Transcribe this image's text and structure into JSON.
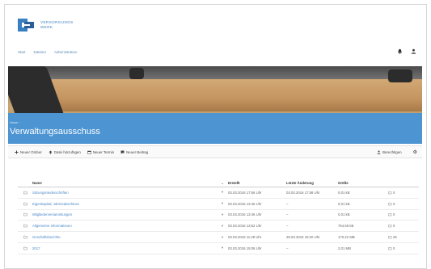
{
  "brand": {
    "line1": "VERSORGUNGS",
    "line2": "WERK"
  },
  "topnav": [
    "Start",
    "Dateien",
    "Administration"
  ],
  "hero": {
    "breadcrumb": "Home ›",
    "title": "Verwaltungsausschuss"
  },
  "toolbar": {
    "new_folder": "Neuer Ordner",
    "upload": "Datei hinzufügen",
    "new_date": "Neuer Termin",
    "new_post": "Neuer Beitrag",
    "manage": "Berechtigen",
    "more": "⚙"
  },
  "table": {
    "headers": {
      "name": "Name",
      "modified": "Erstellt",
      "last_change": "Letzte Änderung",
      "size": "Größe"
    },
    "rows": [
      {
        "name": "Sitzungsniederschriften",
        "modified": "03.03.2016 17:56 Uhr",
        "last_change": "03.03.2016 17:58 Uhr",
        "size": "0,01 kB",
        "share": "0"
      },
      {
        "name": "Eigenkapital, Jahresabschluss",
        "modified": "03.03.2016 13:46 Uhr",
        "last_change": "–",
        "size": "0,01 kB",
        "share": "0"
      },
      {
        "name": "Mitgliederversammlungen",
        "modified": "03.03.2016 13:46 Uhr",
        "last_change": "–",
        "size": "0,01 kB",
        "share": "0"
      },
      {
        "name": "Allgemeine Informationen",
        "modified": "03.03.2016 13:52 Uhr",
        "last_change": "–",
        "size": "754,55 kB",
        "share": "0"
      },
      {
        "name": "Geschäftsberichte",
        "modified": "03.03.2016 11:28 Uhr",
        "last_change": "28.03.2016 15:20 Uhr",
        "size": "170,22 MB",
        "share": "26"
      },
      {
        "name": "2017",
        "modified": "03.03.2016 15:06 Uhr",
        "last_change": "–",
        "size": "2,01 MB",
        "share": "0"
      }
    ]
  },
  "colors": {
    "accent": "#4d94d2",
    "link": "#4b89c8"
  }
}
